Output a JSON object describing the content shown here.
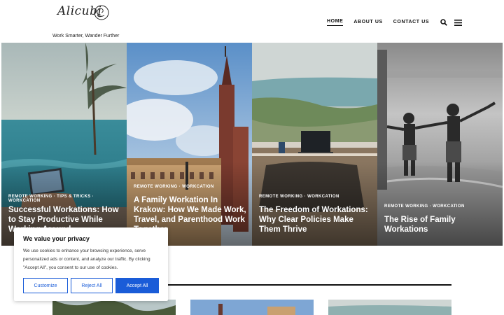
{
  "header": {
    "logo_text": "Alicubi",
    "tagline": "Work Smarter, Wander Further",
    "nav": [
      {
        "label": "HOME"
      },
      {
        "label": "ABOUT US"
      },
      {
        "label": "CONTACT US"
      }
    ]
  },
  "slides": [
    {
      "categories": "REMOTE WORKING · TIPS & TRICKS · WORKCATION",
      "title": "Successful Workations: How to Stay Productive While Working Around..."
    },
    {
      "categories": "REMOTE WORKING · WORKCATION",
      "title": "A Family Workation In Krakow: How We Made Work, Travel, and Parenthood Work Together"
    },
    {
      "categories": "REMOTE WORKING · WORKCATION",
      "title": "The Freedom of Workations: Why Clear Policies Make Them Thrive"
    },
    {
      "categories": "REMOTE WORKING · WORKCATION",
      "title": "The Rise of Family Workations"
    }
  ],
  "cookie": {
    "title": "We value your privacy",
    "text": "We use cookies to enhance your browsing experience, serve personalized ads or content, and analyze our traffic. By clicking \"Accept All\", you consent to our use of cookies.",
    "customize": "Customize",
    "reject": "Reject All",
    "accept": "Accept All"
  },
  "colors": {
    "accent": "#1a5cd8"
  }
}
